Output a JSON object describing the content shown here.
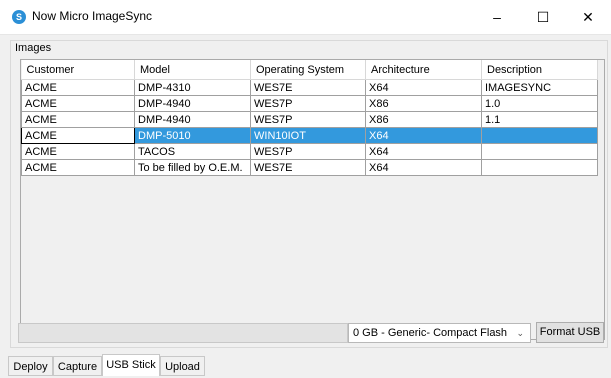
{
  "window": {
    "title": "Now Micro ImageSync",
    "minimize": "–",
    "maximize": "☐",
    "close": "✕",
    "app_icon": "S"
  },
  "group": {
    "label": "Images"
  },
  "table": {
    "columns": [
      "Customer",
      "Model",
      "Operating System",
      "Architecture",
      "Description"
    ],
    "rows": [
      [
        "ACME",
        "DMP-4310",
        "WES7E",
        "X64",
        "IMAGESYNC"
      ],
      [
        "ACME",
        "DMP-4940",
        "WES7P",
        "X86",
        "1.0"
      ],
      [
        "ACME",
        "DMP-4940",
        "WES7P",
        "X86",
        "1.1"
      ],
      [
        "ACME",
        "DMP-5010",
        "WIN10IOT",
        "X64",
        ""
      ],
      [
        "ACME",
        "TACOS",
        "WES7P",
        "X64",
        ""
      ],
      [
        "ACME",
        "To be filled by O.E.M.",
        "WES7E",
        "X64",
        ""
      ]
    ],
    "selected_row": 3
  },
  "drive_select": {
    "value": "0 GB - Generic- Compact Flash"
  },
  "format_button": {
    "label": "Format USB"
  },
  "tabs": [
    "Deploy",
    "Capture",
    "USB Stick",
    "Upload"
  ],
  "active_tab": "USB Stick",
  "colors": {
    "selection": "#3399dd"
  }
}
